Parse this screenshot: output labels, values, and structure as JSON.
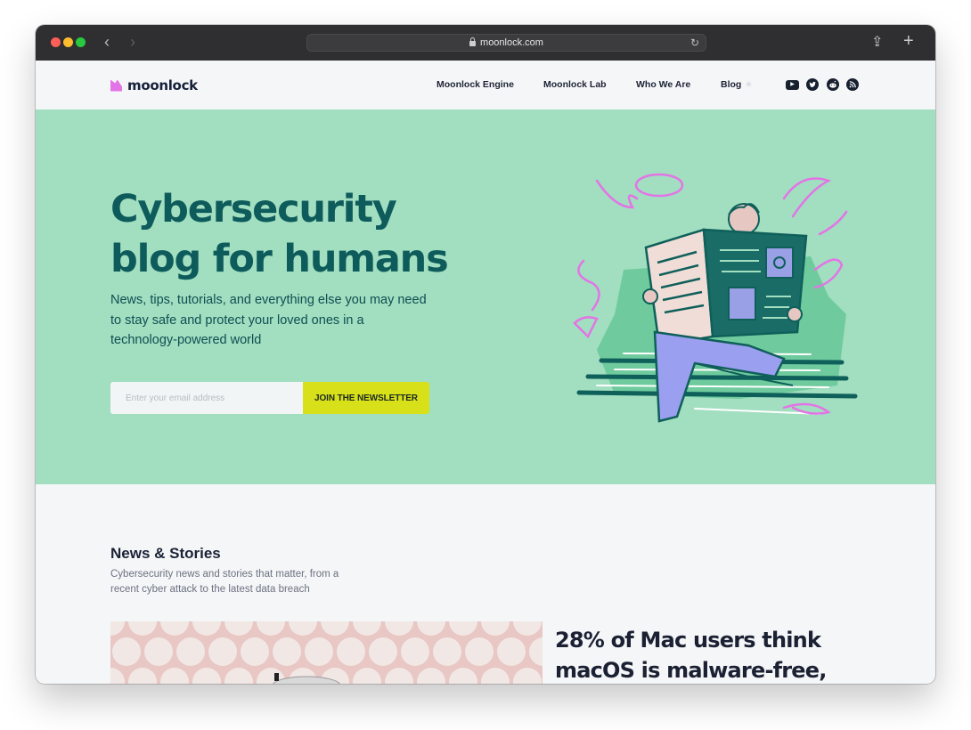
{
  "browser": {
    "url": "moonlock.com",
    "icons": [
      "back-arrow-icon",
      "forward-arrow-icon",
      "lock-icon",
      "reload-icon",
      "share-icon",
      "new-tab-icon"
    ]
  },
  "header": {
    "logo_text": "moonlock",
    "nav": [
      {
        "label": "Moonlock Engine"
      },
      {
        "label": "Moonlock Lab"
      },
      {
        "label": "Who We Are"
      },
      {
        "label": "Blog"
      }
    ],
    "social_icons": [
      "youtube-icon",
      "twitter-icon",
      "reddit-icon",
      "rss-icon"
    ]
  },
  "hero": {
    "title": "Cybersecurity blog for humans",
    "subtitle": "News, tips, tutorials, and everything else you may need to stay safe and protect your loved ones in a technology-powered world",
    "email_placeholder": "Enter your email address",
    "cta_label": "JOIN THE NEWSLETTER"
  },
  "news": {
    "title": "News & Stories",
    "subtitle": "Cybersecurity news and stories that matter, from a recent cyber attack to the latest data breach",
    "featured_headline": "28% of Mac users think macOS is malware-free,"
  },
  "colors": {
    "hero_bg": "#a2dec0",
    "title_teal": "#0e5b5c",
    "cta_yellow": "#d8e01a",
    "accent_pink": "#e374e6"
  }
}
